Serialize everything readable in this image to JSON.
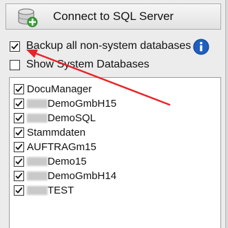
{
  "connect_button": {
    "label": "Connect to SQL Server",
    "icon": "database-add-icon"
  },
  "options": {
    "backup_all": {
      "label": "Backup all non-system databases",
      "checked": true
    },
    "show_system": {
      "label": "Show System Databases",
      "checked": false
    },
    "info_icon": "info-icon"
  },
  "databases": [
    {
      "prefix_redacted": false,
      "name": "DocuManager",
      "checked": true
    },
    {
      "prefix_redacted": true,
      "name": "DemoGmbH15",
      "checked": true
    },
    {
      "prefix_redacted": true,
      "name": "DemoSQL",
      "checked": true
    },
    {
      "prefix_redacted": false,
      "name": "Stammdaten",
      "checked": true
    },
    {
      "prefix_redacted": false,
      "name": "AUFTRAGm15",
      "checked": true
    },
    {
      "prefix_redacted": true,
      "name": "Demo15",
      "checked": true
    },
    {
      "prefix_redacted": true,
      "name": "DemoGmbH14",
      "checked": true
    },
    {
      "prefix_redacted": true,
      "name": "TEST",
      "checked": true
    }
  ],
  "colors": {
    "annotation_arrow": "#e8232a",
    "info_blue": "#1f5fbf"
  }
}
